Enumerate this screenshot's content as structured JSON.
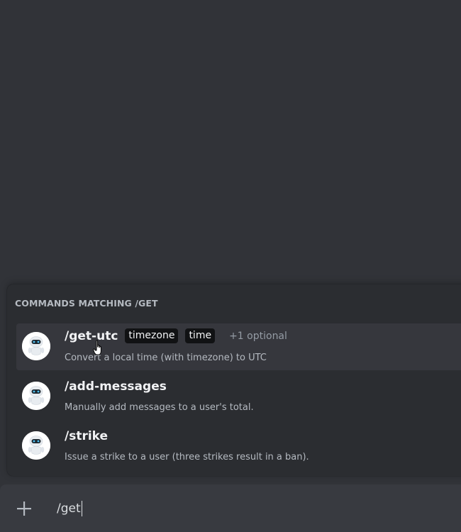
{
  "popup": {
    "header": "COMMANDS MATCHING /GET",
    "commands": [
      {
        "name": "/get-utc",
        "options": [
          "timezone",
          "time"
        ],
        "extra": "+1 optional",
        "description": "Convert a local time (with timezone) to UTC"
      },
      {
        "name": "/add-messages",
        "description": "Manually add messages to a user's total."
      },
      {
        "name": "/strike",
        "description": "Issue a strike to a user (three strikes result in a ban)."
      }
    ]
  },
  "composer": {
    "text": "/get"
  },
  "colors": {
    "background": "#313338",
    "popup": "#2b2d31",
    "selected_row": "#36373d",
    "chip": "#111214",
    "composer": "#383a40"
  },
  "icons": {
    "bot_avatar": "robot-avatar-icon",
    "add": "plus-icon",
    "cursor": "hand-pointer-icon"
  }
}
